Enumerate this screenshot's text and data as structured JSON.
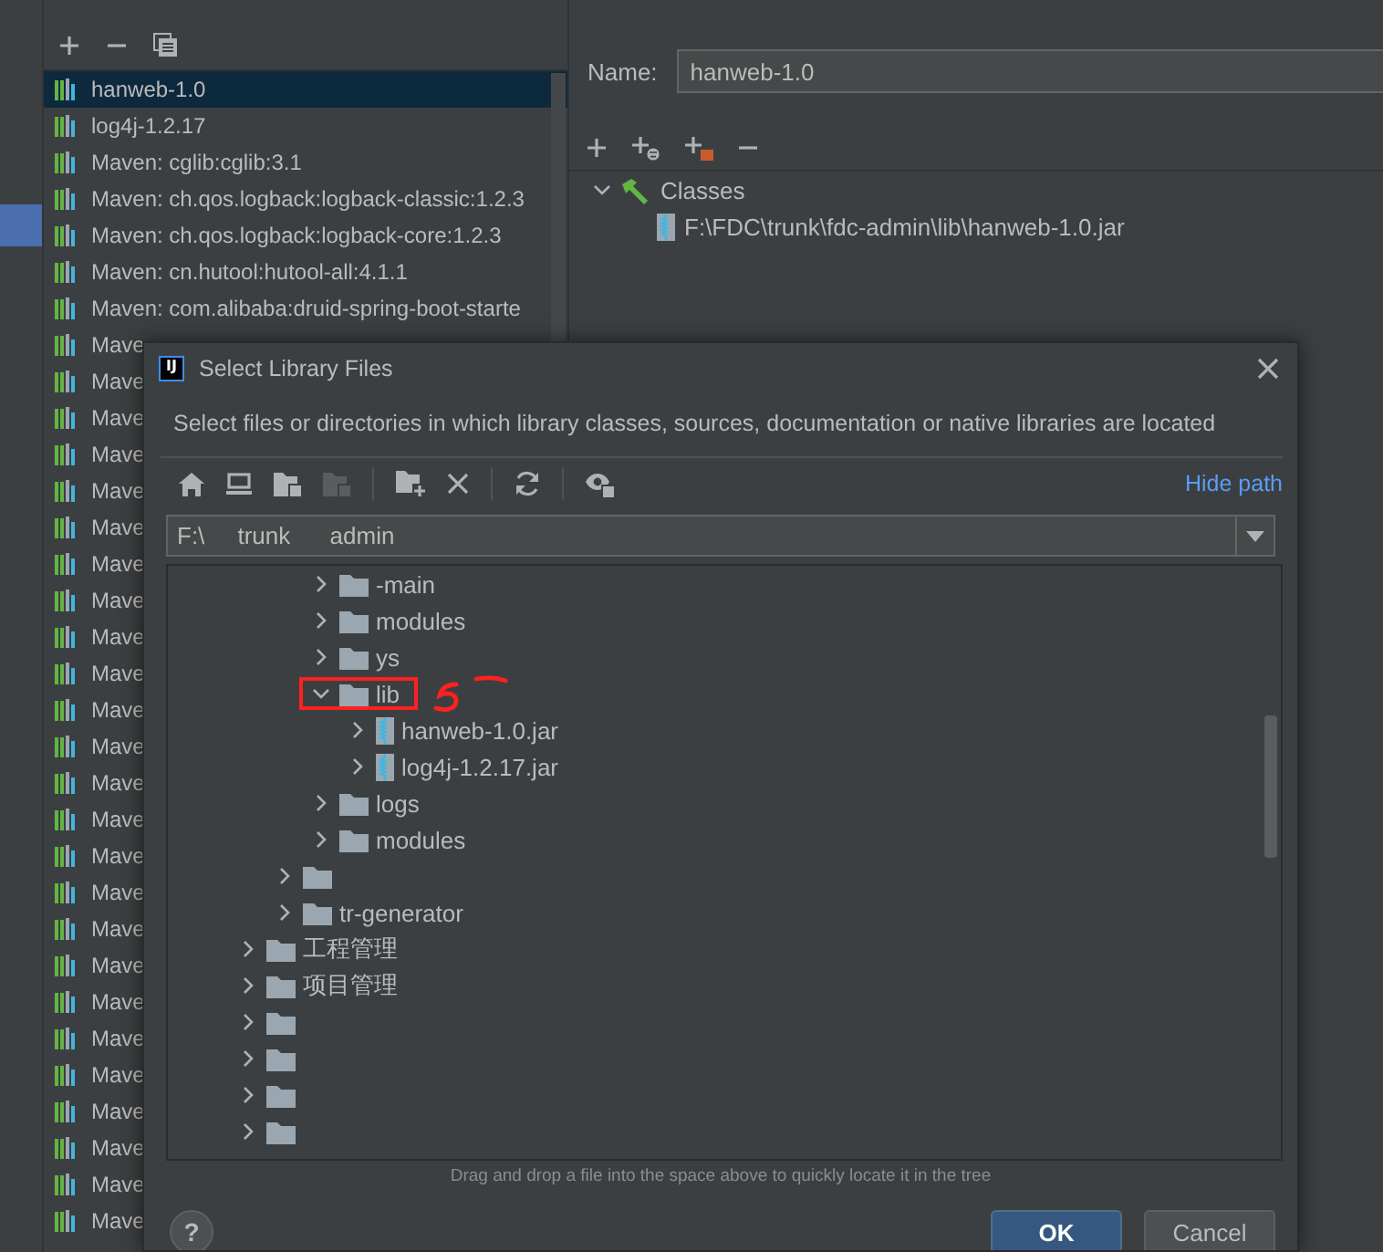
{
  "libraries": [
    {
      "label": "hanweb-1.0",
      "selected": true
    },
    {
      "label": "log4j-1.2.17",
      "selected": false
    },
    {
      "label": "Maven: cglib:cglib:3.1",
      "selected": false
    },
    {
      "label": "Maven: ch.qos.logback:logback-classic:1.2.3",
      "selected": false
    },
    {
      "label": "Maven: ch.qos.logback:logback-core:1.2.3",
      "selected": false
    },
    {
      "label": "Maven: cn.hutool:hutool-all:4.1.1",
      "selected": false
    },
    {
      "label": "Maven: com.alibaba:druid-spring-boot-starte",
      "selected": false
    },
    {
      "label": "Mave",
      "selected": false
    },
    {
      "label": "Mave",
      "selected": false
    },
    {
      "label": "Mave",
      "selected": false
    },
    {
      "label": "Mave",
      "selected": false
    },
    {
      "label": "Mave",
      "selected": false
    },
    {
      "label": "Mave",
      "selected": false
    },
    {
      "label": "Mave",
      "selected": false
    },
    {
      "label": "Mave",
      "selected": false
    },
    {
      "label": "Mave",
      "selected": false
    },
    {
      "label": "Mave",
      "selected": false
    },
    {
      "label": "Mave",
      "selected": false
    },
    {
      "label": "Mave",
      "selected": false
    },
    {
      "label": "Mave",
      "selected": false
    },
    {
      "label": "Mave",
      "selected": false
    },
    {
      "label": "Mave",
      "selected": false
    },
    {
      "label": "Mave",
      "selected": false
    },
    {
      "label": "Mave",
      "selected": false
    },
    {
      "label": "Mave",
      "selected": false
    },
    {
      "label": "Mave",
      "selected": false
    },
    {
      "label": "Mave",
      "selected": false
    },
    {
      "label": "Mave",
      "selected": false
    },
    {
      "label": "Mave",
      "selected": false
    },
    {
      "label": "Mave",
      "selected": false
    },
    {
      "label": "Mave",
      "selected": false
    },
    {
      "label": "Mave",
      "selected": false
    }
  ],
  "editor": {
    "name_label": "Name:",
    "name_value": "hanweb-1.0",
    "roots": [
      {
        "label": "Classes",
        "expanded": true,
        "children": [
          {
            "label": "F:\\FDC\\trunk\\fdc-admin\\lib\\hanweb-1.0.jar"
          }
        ]
      }
    ]
  },
  "dialog": {
    "app_icon": "IJ",
    "title": "Select Library Files",
    "description": "Select files or directories in which library classes, sources, documentation or native libraries are located",
    "hide_path_link": "Hide path",
    "path": "F:\\     trunk      admin",
    "tree": [
      {
        "children": [
          {
            "children": [
              {
                "kind": "folder",
                "label": "-main",
                "expanded": false,
                "annotated": false
              },
              {
                "kind": "folder",
                "label": "modules",
                "expanded": false,
                "annotated": false
              },
              {
                "kind": "folder",
                "label": "ys",
                "expanded": false,
                "annotated": false
              },
              {
                "kind": "folder",
                "label": "lib",
                "expanded": true,
                "annotated": true,
                "children": [
                  {
                    "kind": "jar",
                    "label": "hanweb-1.0.jar",
                    "expanded": false,
                    "annotated": false
                  },
                  {
                    "kind": "jar",
                    "label": "log4j-1.2.17.jar",
                    "expanded": false,
                    "annotated": false
                  }
                ]
              },
              {
                "kind": "folder",
                "label": "logs",
                "expanded": false,
                "annotated": false
              },
              {
                "kind": "folder",
                "label": "modules",
                "expanded": false,
                "annotated": false
              }
            ]
          },
          {
            "kind": "folder",
            "expanded": false,
            "annotated": false
          },
          {
            "kind": "folder",
            "label": "tr-generator",
            "expanded": false,
            "annotated": false
          }
        ]
      },
      {
        "kind": "folder",
        "label": "工程管理",
        "expanded": false,
        "annotated": false
      },
      {
        "kind": "folder",
        "label": "项目管理",
        "expanded": false,
        "annotated": false
      },
      {
        "kind": "folder",
        "expanded": false,
        "annotated": false
      },
      {
        "kind": "folder",
        "expanded": false,
        "annotated": false
      },
      {
        "kind": "folder",
        "expanded": false,
        "annotated": false
      },
      {
        "kind": "folder",
        "expanded": false,
        "annotated": false
      }
    ],
    "hint": "Drag and drop a file into the space above to quickly locate it in the tree",
    "help": "?",
    "buttons": [
      {
        "label": "OK",
        "default": true
      },
      {
        "label": "Cancel",
        "default": false
      }
    ]
  }
}
